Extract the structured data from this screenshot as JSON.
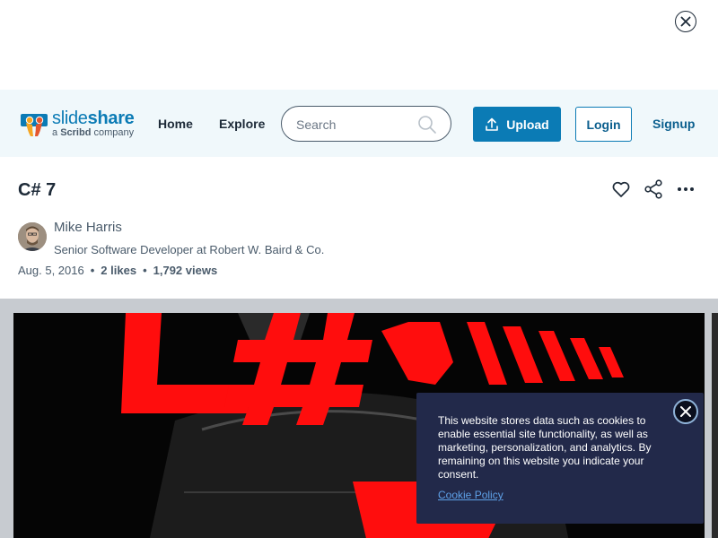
{
  "ad": {
    "close_icon": "close-icon"
  },
  "header": {
    "logo": {
      "word_light": "slide",
      "word_bold": "share",
      "sub_prefix": "a ",
      "sub_brand": "Scribd",
      "sub_suffix": " company"
    },
    "nav": [
      "Home",
      "Explore"
    ],
    "search": {
      "placeholder": "Search",
      "value": "",
      "icon": "search-icon"
    },
    "upload_label": "Upload",
    "login_label": "Login",
    "signup_label": "Signup",
    "accent_color": "#0b7bb5"
  },
  "document": {
    "title": "C# 7",
    "actions": [
      "heart-icon",
      "share-icon",
      "more-icon"
    ],
    "author": {
      "name": "Mike Harris",
      "role": "Senior Software Developer at Robert W. Baird & Co."
    },
    "date": "Aug. 5, 2016",
    "likes": "2 likes",
    "views": "1,792 views"
  },
  "cookie": {
    "text": "This website stores data such as cookies to enable essential site functionality, as well as marketing, personalization, and analytics. By remaining on this website you indicate your consent.",
    "link": "Cookie Policy",
    "close_icon": "close-icon"
  }
}
